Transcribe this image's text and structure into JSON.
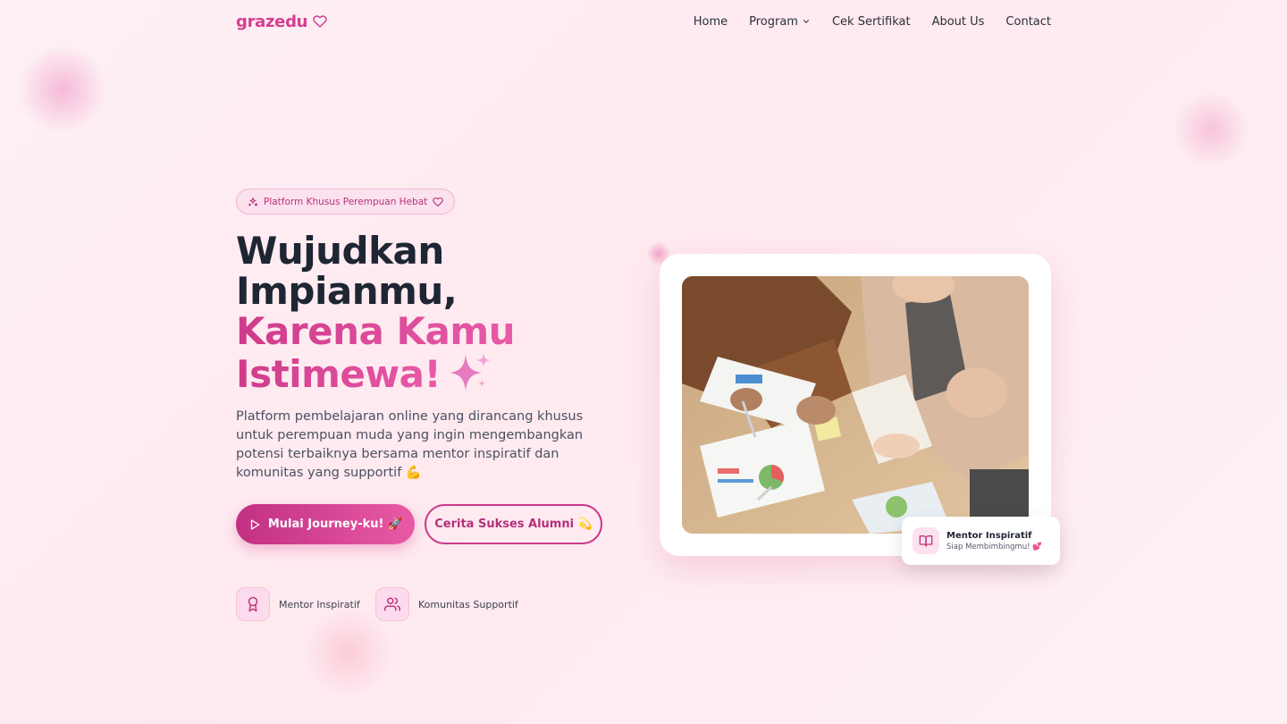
{
  "nav": {
    "logo": "grazedu",
    "items": [
      {
        "label": "Home"
      },
      {
        "label": "Program"
      },
      {
        "label": "Cek Sertifikat"
      },
      {
        "label": "About Us"
      },
      {
        "label": "Contact"
      }
    ]
  },
  "hero": {
    "badge": "Platform Khusus Perempuan Hebat",
    "title_line1": "Wujudkan",
    "title_line2": "Impianmu,",
    "title_line3": "Karena Kamu",
    "title_line4": "Istimewa!",
    "description": "Platform pembelajaran online yang dirancang khusus untuk perempuan muda yang ingin mengembangkan potensi terbaiknya bersama mentor inspiratif dan komunitas yang supportif 💪",
    "primary_button": "Mulai Journey-ku! 🚀",
    "secondary_button": "Cerita Sukses Alumni 💫",
    "features": [
      {
        "label": "Mentor Inspiratif",
        "icon": "award-icon"
      },
      {
        "label": "Komunitas Supportif",
        "icon": "users-icon"
      }
    ]
  },
  "mentor_card": {
    "title": "Mentor Inspiratif",
    "subtitle": "Siap Membimbingmu! 💕",
    "icon": "book-open-icon"
  },
  "colors": {
    "brand": "#d63d8f",
    "brand_light": "#fce1ee",
    "dark_text": "#1e2533"
  }
}
